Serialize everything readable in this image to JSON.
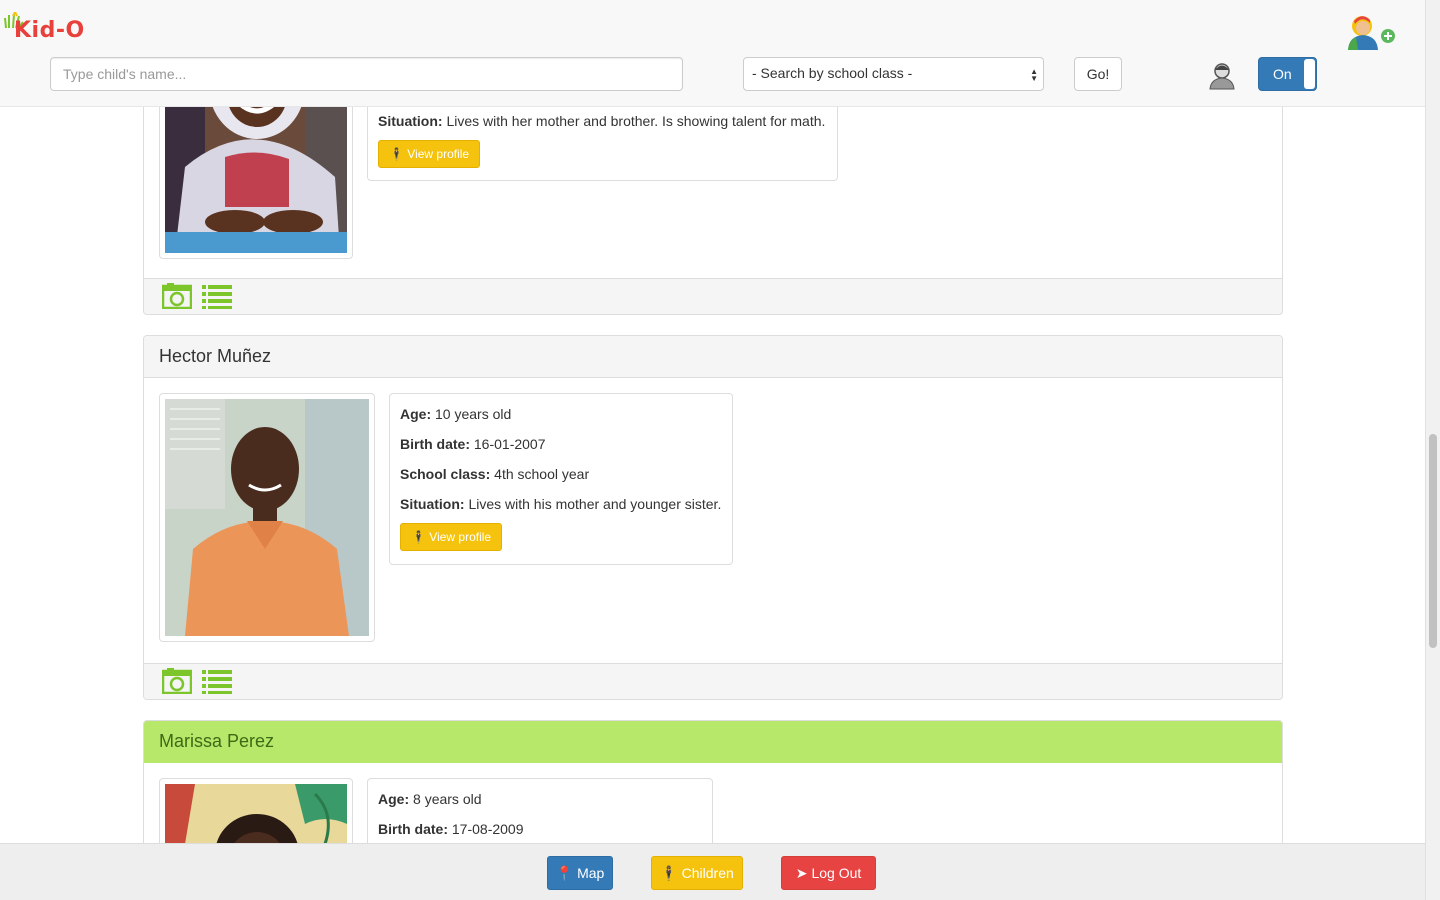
{
  "app": {
    "logo_text": "Kid-O"
  },
  "header": {
    "search_placeholder": "Type child's name...",
    "class_select_value": "- Search by school class -",
    "go_label": "Go!",
    "toggle_label": "On"
  },
  "children": [
    {
      "name": "",
      "situation_label": "Situation:",
      "situation": "Lives with her mother and brother. Is showing talent for math.",
      "view_profile": "View profile"
    },
    {
      "name": "Hector Muñez",
      "age_label": "Age:",
      "age": "10 years old",
      "birth_label": "Birth date:",
      "birth_date": "16-01-2007",
      "class_label": "School class:",
      "school_class": "4th school year",
      "situation_label": "Situation:",
      "situation": "Lives with his mother and younger sister.",
      "view_profile": "View profile"
    },
    {
      "name": "Marissa Perez",
      "age_label": "Age:",
      "age": "8 years old",
      "birth_label": "Birth date:",
      "birth_date": "17-08-2009"
    }
  ],
  "bottom_nav": {
    "map_label": "Map",
    "children_label": "Children",
    "logout_label": "Log Out"
  },
  "colors": {
    "primary": "#337ab7",
    "warning": "#f5c30e",
    "danger": "#e84343",
    "active_panel": "#b8e86a",
    "icon_green": "#7cc52a"
  }
}
